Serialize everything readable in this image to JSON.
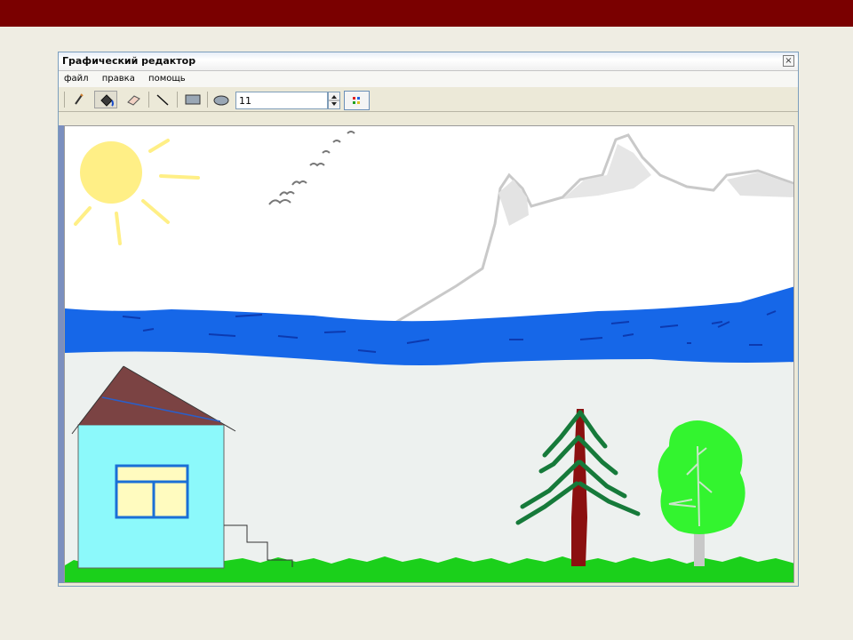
{
  "window": {
    "title": "Графический редактор",
    "close_glyph": "×"
  },
  "menu": {
    "items": [
      "файл",
      "правка",
      "помощь"
    ]
  },
  "toolbar": {
    "tools": [
      {
        "name": "pencil-icon"
      },
      {
        "name": "fill-bucket-icon",
        "active": true
      },
      {
        "name": "eraser-icon"
      },
      {
        "name": "line-icon"
      },
      {
        "name": "rectangle-icon"
      },
      {
        "name": "ellipse-icon"
      }
    ],
    "brush_size": "11",
    "palette_icon": "color-palette-icon"
  },
  "colors": {
    "top_bar": "#7a0000",
    "page_background": "#efede3",
    "water": "#1667e8",
    "grass": "#1bd01b",
    "house_wall": "#8cf9fb",
    "roof": "#7b4343",
    "sun": "#ffef86",
    "spruce": "#167a3a",
    "birch_crown": "#33f42f",
    "mountains": "#c9c9c9"
  }
}
